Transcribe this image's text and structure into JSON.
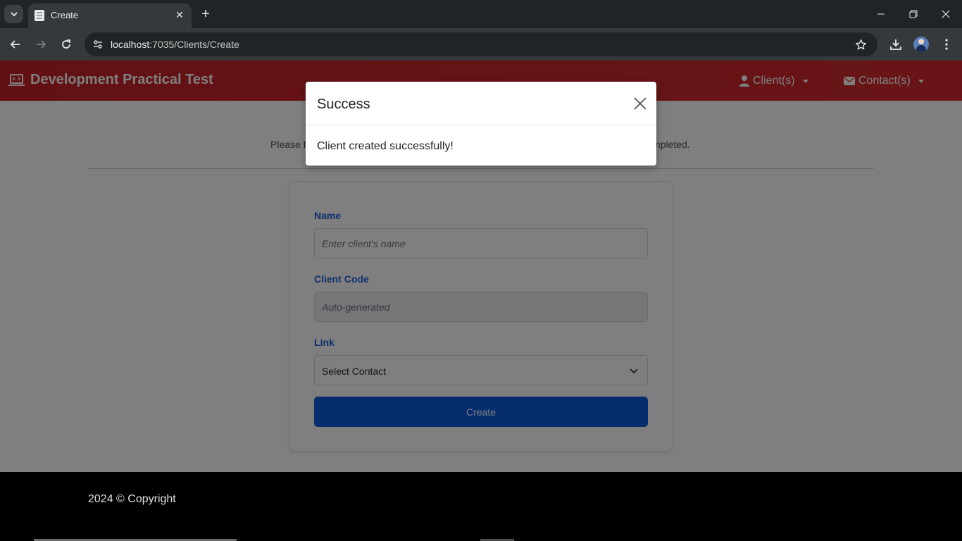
{
  "browser": {
    "tab_title": "Create",
    "url_host": "localhost",
    "url_path": ":7035/Clients/Create"
  },
  "navbar": {
    "brand": "Development Practical Test",
    "menu_clients": "Client(s)",
    "menu_contacts": "Contact(s)"
  },
  "page": {
    "instructions_left": "Please fi",
    "instructions_right": "mpleted.",
    "form": {
      "name_label": "Name",
      "name_placeholder": "Enter client's name",
      "code_label": "Client Code",
      "code_placeholder": "Auto-generated",
      "link_label": "Link",
      "link_selected": "Select Contact",
      "create_label": "Create"
    }
  },
  "modal": {
    "title": "Success",
    "message": "Client created successfully!"
  },
  "footer": {
    "text": "2024 © Copyright"
  },
  "colors": {
    "navbar": "#c42128",
    "label_blue": "#1b5fd6",
    "button_blue": "#0d5bdd"
  }
}
